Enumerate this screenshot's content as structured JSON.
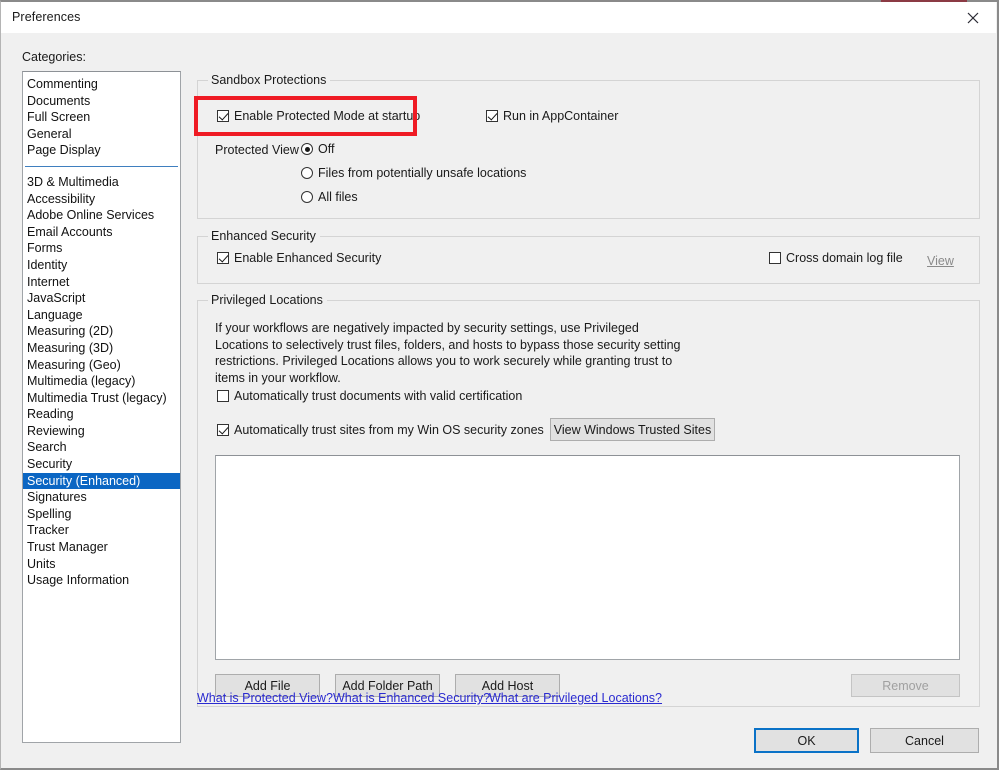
{
  "window": {
    "title": "Preferences",
    "close_icon": "close-icon",
    "accent_color": "#8b3a44"
  },
  "sidebar": {
    "label": "Categories:",
    "group_one": [
      "Commenting",
      "Documents",
      "Full Screen",
      "General",
      "Page Display"
    ],
    "group_two": [
      "3D & Multimedia",
      "Accessibility",
      "Adobe Online Services",
      "Email Accounts",
      "Forms",
      "Identity",
      "Internet",
      "JavaScript",
      "Language",
      "Measuring (2D)",
      "Measuring (3D)",
      "Measuring (Geo)",
      "Multimedia (legacy)",
      "Multimedia Trust (legacy)",
      "Reading",
      "Reviewing",
      "Search",
      "Security",
      "Security (Enhanced)",
      "Signatures",
      "Spelling",
      "Tracker",
      "Trust Manager",
      "Units",
      "Usage Information"
    ],
    "selected": "Security (Enhanced)",
    "selection_color": "#0b66c3",
    "separator_color": "#3f7fbf"
  },
  "sandbox": {
    "title": "Sandbox Protections",
    "enable_protected_mode": {
      "label": "Enable Protected Mode at startup",
      "checked": true,
      "highlighted": true,
      "highlight_color": "#ef1b24"
    },
    "run_in_appcontainer": {
      "label": "Run in AppContainer",
      "checked": true
    },
    "protected_view": {
      "label": "Protected View",
      "selected": "Off",
      "options": [
        "Off",
        "Files from potentially unsafe locations",
        "All files"
      ]
    }
  },
  "enhanced_security": {
    "title": "Enhanced Security",
    "enable": {
      "label": "Enable Enhanced Security",
      "checked": true
    },
    "cross_domain": {
      "label": "Cross domain log file",
      "checked": false
    },
    "view_link": "View"
  },
  "privileged_locations": {
    "title": "Privileged Locations",
    "description": "If your workflows are negatively impacted by security settings, use Privileged Locations to selectively trust files, folders, and hosts to bypass those security setting restrictions. Privileged Locations allows you to work securely while granting trust to items in your workflow.",
    "trust_documents": {
      "label": "Automatically trust documents with valid certification",
      "checked": false
    },
    "trust_sites": {
      "label": "Automatically trust sites from my Win OS security zones",
      "checked": true
    },
    "view_trusted_sites_button": "View Windows Trusted Sites",
    "list_items": [],
    "add_file_button": "Add File",
    "add_folder_button": "Add Folder Path",
    "add_host_button": "Add Host",
    "remove_button": "Remove",
    "remove_disabled": true
  },
  "help_links": [
    "What is Protected View?",
    "What is Enhanced Security?",
    "What are Privileged Locations?"
  ],
  "footer": {
    "ok_label": "OK",
    "cancel_label": "Cancel",
    "focus_color": "#0a72c7"
  }
}
